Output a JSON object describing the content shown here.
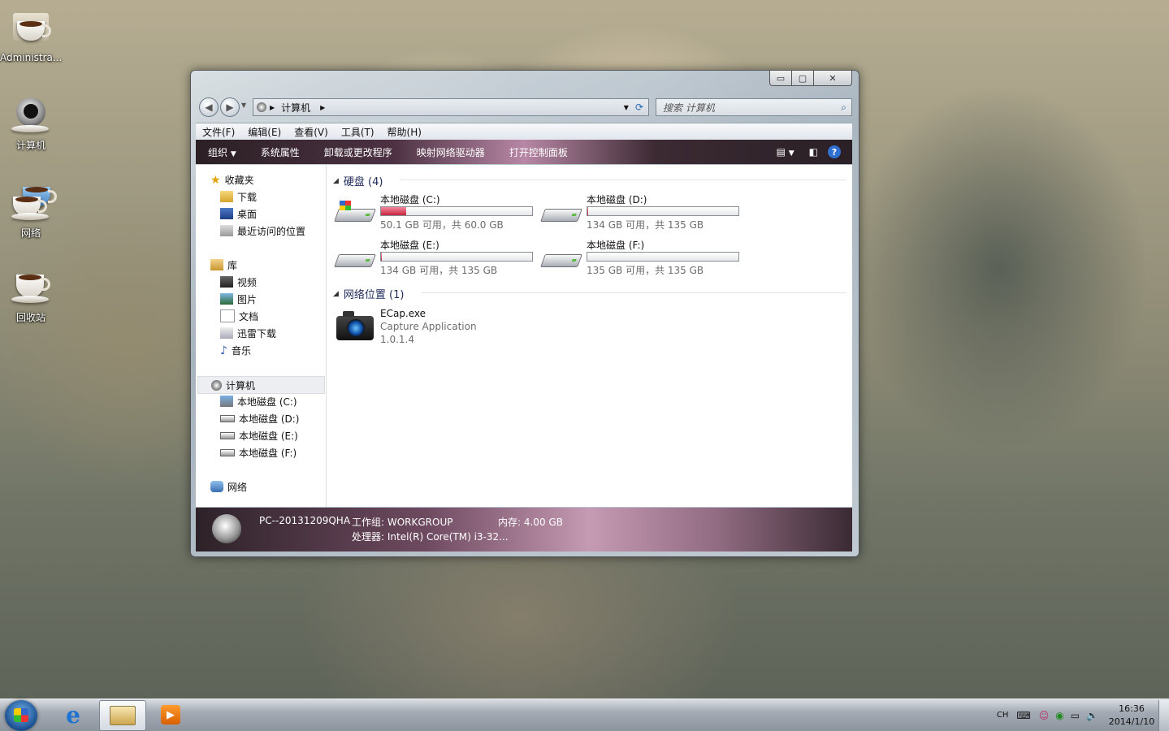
{
  "desktop": {
    "icons": [
      {
        "label": "Administra..."
      },
      {
        "label": "计算机"
      },
      {
        "label": "网络"
      },
      {
        "label": "回收站"
      }
    ]
  },
  "window": {
    "controls": {
      "minimize": "▭",
      "maximize": "▢",
      "close": "✕"
    },
    "address": {
      "crumb": "计算机"
    },
    "search": {
      "placeholder": "搜索 计算机"
    },
    "menu": [
      "文件(F)",
      "编辑(E)",
      "查看(V)",
      "工具(T)",
      "帮助(H)"
    ],
    "toolbar": {
      "organize": "组织",
      "items": [
        "系统属性",
        "卸载或更改程序",
        "映射网络驱动器",
        "打开控制面板"
      ]
    },
    "nav": {
      "favorites": {
        "title": "收藏夹",
        "items": [
          "下载",
          "桌面",
          "最近访问的位置"
        ]
      },
      "library": {
        "title": "库",
        "items": [
          "视频",
          "图片",
          "文档",
          "迅雷下载",
          "音乐"
        ]
      },
      "computer": {
        "title": "计算机",
        "items": [
          "本地磁盘 (C:)",
          "本地磁盘 (D:)",
          "本地磁盘 (E:)",
          "本地磁盘 (F:)"
        ]
      },
      "network": {
        "title": "网络"
      }
    },
    "content": {
      "hdd_group": "硬盘 (4)",
      "drives": [
        {
          "name": "本地磁盘 (C:)",
          "free": "50.1 GB 可用，共 60.0 GB",
          "used_fraction": 0.165
        },
        {
          "name": "本地磁盘 (D:)",
          "free": "134 GB 可用，共 135 GB",
          "used_fraction": 0.007
        },
        {
          "name": "本地磁盘 (E:)",
          "free": "134 GB 可用，共 135 GB",
          "used_fraction": 0.007
        },
        {
          "name": "本地磁盘 (F:)",
          "free": "135 GB 可用，共 135 GB",
          "used_fraction": 0.0
        }
      ],
      "net_group": "网络位置 (1)",
      "net_item": {
        "name": "ECap.exe",
        "desc": "Capture Application",
        "version": "1.0.1.4"
      }
    },
    "status": {
      "pc_name": "PC--20131209QHA",
      "workgroup": "工作组: WORKGROUP",
      "memory": "内存: 4.00 GB",
      "cpu": "处理器: Intel(R) Core(TM) i3-32..."
    }
  },
  "taskbar": {
    "lang": "CH",
    "time": "16:36",
    "date": "2014/1/10"
  }
}
